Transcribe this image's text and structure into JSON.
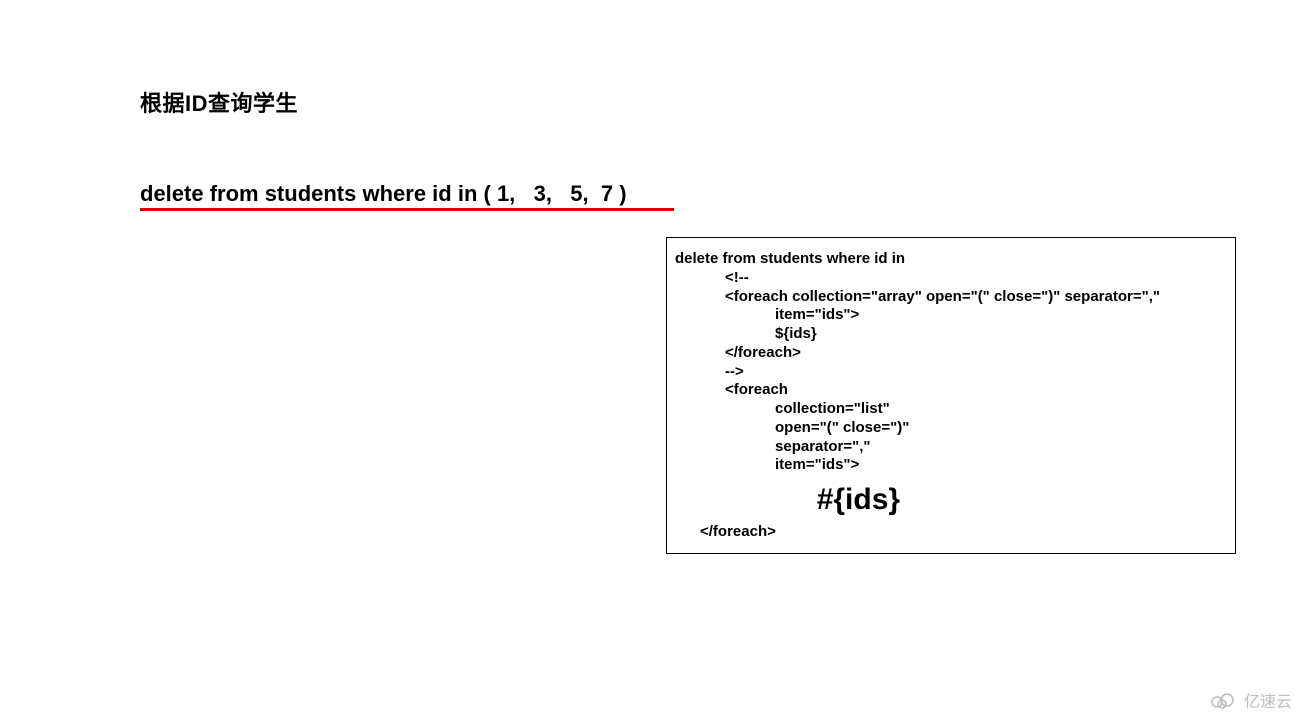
{
  "heading": "根据ID查询学生",
  "sql_line": "delete from students where id in ( 1,   3,   5,  7 )",
  "code": {
    "l1": "delete from students where id in",
    "l2": "            <!--",
    "l3": "            <foreach collection=\"array\" open=\"(\" close=\")\" separator=\",\"",
    "l4": "                        item=\"ids\">",
    "l5": "                        ${ids}",
    "l6": "            </foreach>",
    "l7": "            -->",
    "l8": "            <foreach",
    "l9": "                        collection=\"list\"",
    "l10": "                        open=\"(\" close=\")\"",
    "l11": "                        separator=\",\"",
    "l12": "                        item=\"ids\">",
    "big": "                 #{ids}",
    "l13": "      </foreach>"
  },
  "watermark_text": "亿速云"
}
